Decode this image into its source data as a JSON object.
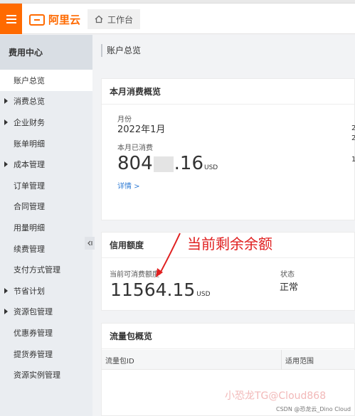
{
  "brand": {
    "name": "阿里云",
    "accent": "#ff6a00"
  },
  "header": {
    "workspace_label": "工作台"
  },
  "sidebar": {
    "title": "费用中心",
    "items": [
      {
        "label": "账户总览",
        "expandable": false,
        "active": true
      },
      {
        "label": "消费总览",
        "expandable": true,
        "active": false
      },
      {
        "label": "企业财务",
        "expandable": true,
        "active": false
      },
      {
        "label": "账单明细",
        "expandable": false,
        "active": false
      },
      {
        "label": "成本管理",
        "expandable": true,
        "active": false
      },
      {
        "label": "订单管理",
        "expandable": false,
        "active": false
      },
      {
        "label": "合同管理",
        "expandable": false,
        "active": false
      },
      {
        "label": "用量明细",
        "expandable": false,
        "active": false
      },
      {
        "label": "续费管理",
        "expandable": false,
        "active": false
      },
      {
        "label": "支付方式管理",
        "expandable": false,
        "active": false
      },
      {
        "label": "节省计划",
        "expandable": true,
        "active": false
      },
      {
        "label": "资源包管理",
        "expandable": true,
        "active": false
      },
      {
        "label": "优惠券管理",
        "expandable": false,
        "active": false
      },
      {
        "label": "提货券管理",
        "expandable": false,
        "active": false
      },
      {
        "label": "资源实例管理",
        "expandable": false,
        "active": false
      }
    ]
  },
  "breadcrumb": {
    "title": "账户总览"
  },
  "monthly": {
    "title": "本月消费概览",
    "month_label": "月份",
    "month_value": "2022年1月",
    "spent_label": "本月已消费",
    "amount_prefix": "804",
    "amount_suffix": ".16",
    "unit": "USD",
    "detail_link": "详情 >",
    "edge_1": "2",
    "edge_2": "2",
    "edge_3": "1"
  },
  "credit": {
    "title": "信用额度",
    "available_label": "当前可消费额度",
    "available_value": "11564.15",
    "unit": "USD",
    "status_label": "状态",
    "status_value": "正常"
  },
  "annotation": {
    "text": "当前剩余余额",
    "color": "#e02020"
  },
  "traffic": {
    "title": "流量包概览",
    "columns": [
      "流量包ID",
      "适用范围"
    ]
  },
  "watermark": {
    "text": "小恐龙TG@Cloud868",
    "credit": "CSDN @恐龙云_Dino Cloud"
  }
}
